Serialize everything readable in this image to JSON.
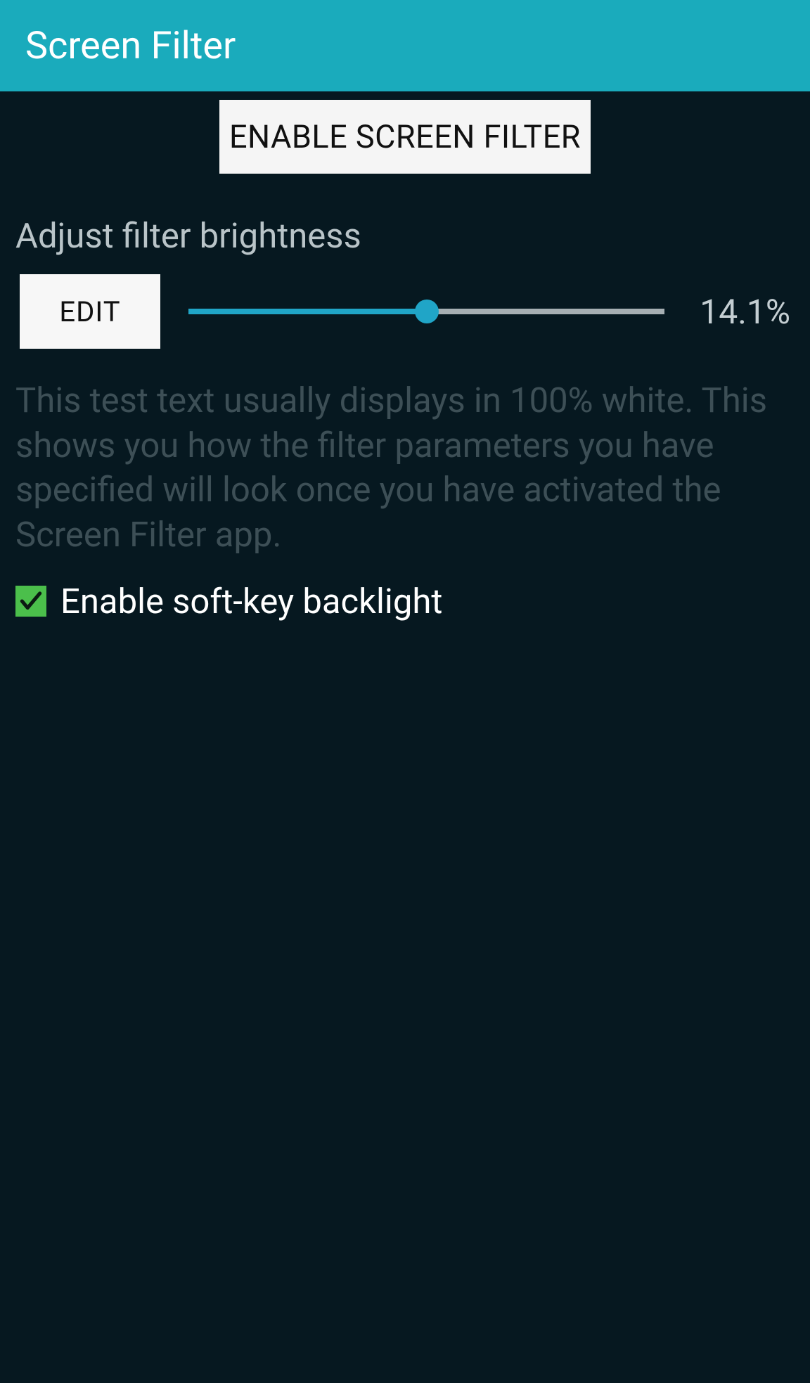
{
  "header": {
    "title": "Screen Filter"
  },
  "main": {
    "enable_button_label": "ENABLE SCREEN FILTER",
    "brightness_heading": "Adjust filter brightness",
    "edit_button_label": "EDIT",
    "slider_value_text": "14.1%",
    "slider_percent": 50,
    "test_text": "This test text usually displays in 100% white. This shows you how the filter parameters you have specified will look once you have activated the Screen Filter app.",
    "softkey_checkbox_label": "Enable soft-key backlight",
    "softkey_checked": true
  },
  "colors": {
    "accent": "#1aabbc",
    "slider_active": "#20a5c7",
    "checkbox_green": "#4bbf4b",
    "bg": "#061820"
  }
}
